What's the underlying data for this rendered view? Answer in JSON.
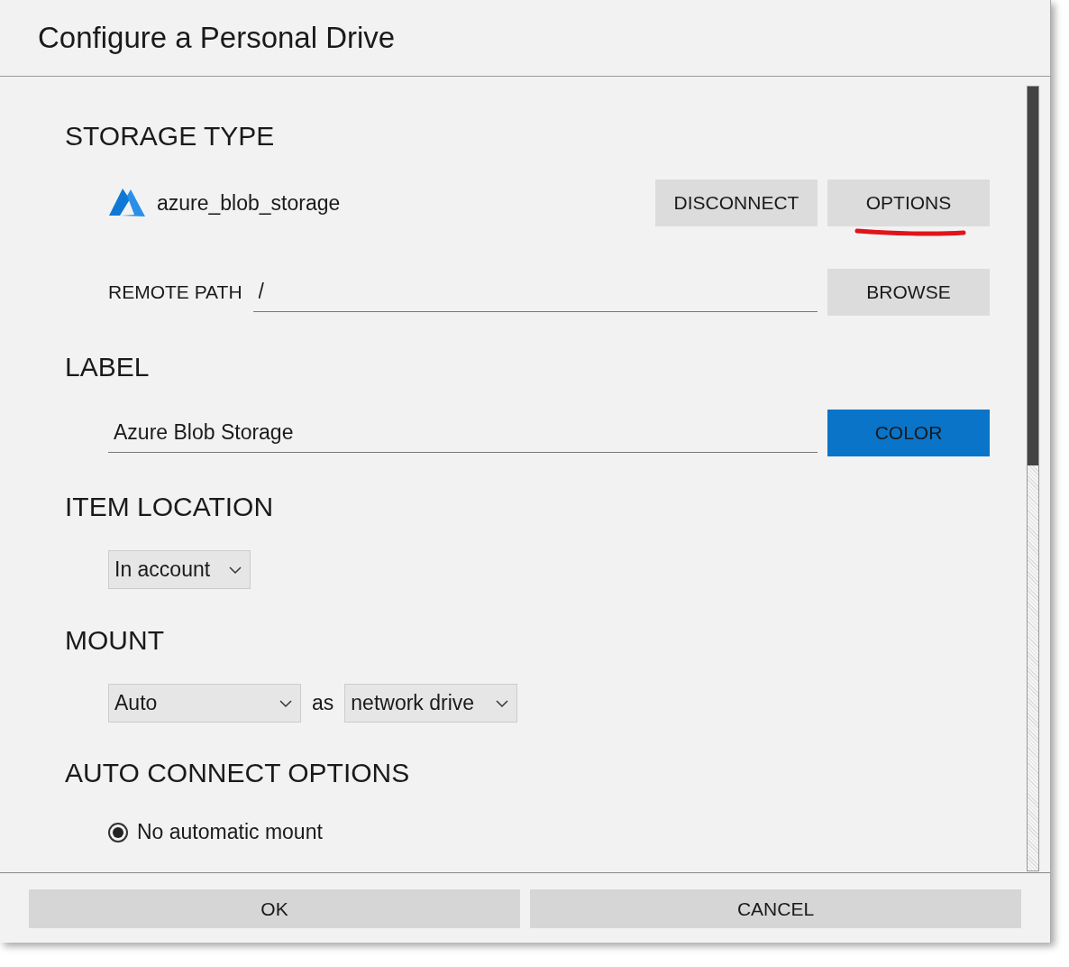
{
  "dialog": {
    "title": "Configure a Personal Drive"
  },
  "storage_type": {
    "heading": "STORAGE TYPE",
    "name": "azure_blob_storage",
    "buttons": [
      {
        "label": "DISCONNECT",
        "annotated": false
      },
      {
        "label": "OPTIONS",
        "annotated": true
      }
    ]
  },
  "remote_path": {
    "label": "REMOTE PATH",
    "value": "/",
    "button": "BROWSE"
  },
  "label": {
    "heading": "LABEL",
    "value": "Azure Blob Storage",
    "button": "COLOR"
  },
  "item_location": {
    "heading": "ITEM LOCATION",
    "value": "In account"
  },
  "mount": {
    "heading": "MOUNT",
    "mode": "Auto",
    "joiner": "as",
    "type": "network drive"
  },
  "auto_connect": {
    "heading": "AUTO CONNECT OPTIONS",
    "options": [
      {
        "label": "No automatic mount",
        "selected": true
      }
    ]
  },
  "footer": {
    "buttons": [
      "OK",
      "CANCEL"
    ]
  }
}
